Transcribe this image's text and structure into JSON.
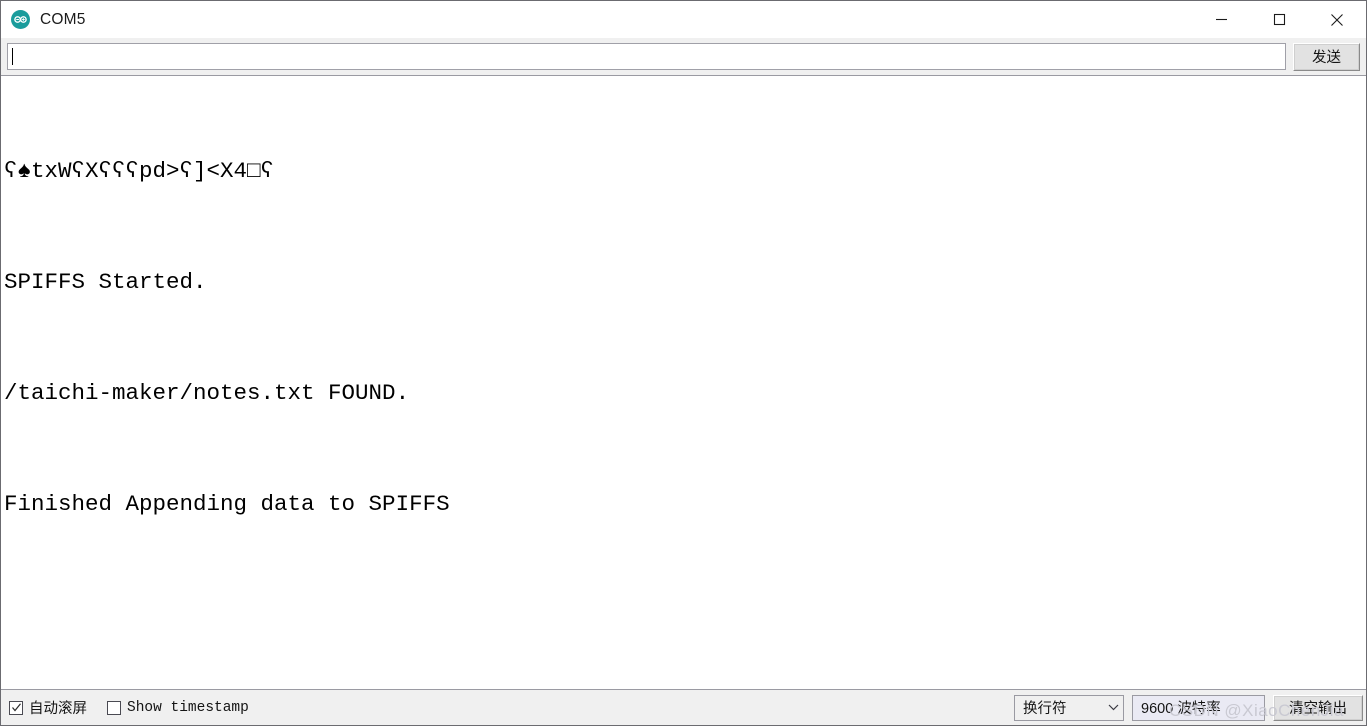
{
  "window": {
    "title": "COM5",
    "app_icon": "arduino-infinity-icon",
    "controls": {
      "minimize": "minimize-icon",
      "maximize": "maximize-icon",
      "close": "close-icon"
    }
  },
  "toolbar": {
    "input_value": "",
    "input_placeholder": "",
    "send_label": "发送"
  },
  "console": {
    "lines": [
      "ʕ♠txWʕXʕʕʕpd>ʕ]<X4□ʕ",
      "SPIFFS Started.",
      "/taichi-maker/notes.txt FOUND.",
      "Finished Appending data to SPIFFS"
    ]
  },
  "statusbar": {
    "autoscroll_label": "自动滚屏",
    "autoscroll_checked": true,
    "timestamp_label": "Show timestamp",
    "timestamp_checked": false,
    "line_ending_value": "换行符",
    "baud_value": "9600 波特率",
    "clear_label": "清空输出",
    "watermark": "CSDN @XiaoChenJia"
  },
  "colors": {
    "accent": "#1a9c9c",
    "window_border": "#6b6b70",
    "toolbar_bg": "#f0f0f0",
    "console_bg": "#ffffff",
    "console_text": "#000000",
    "baud_bg": "#eaeaf4",
    "watermark": "#c9c9d2"
  }
}
